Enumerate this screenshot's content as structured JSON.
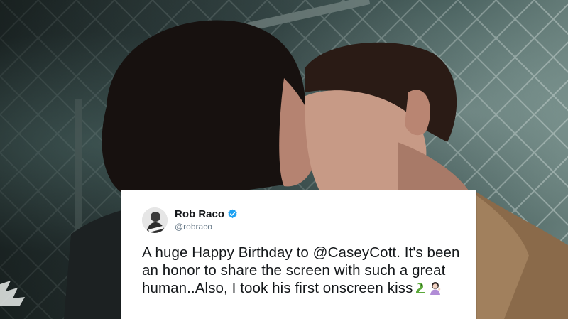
{
  "tweet": {
    "display_name": "Rob Raco",
    "handle": "@robraco",
    "text": "A huge Happy Birthday to @CaseyCott. It's been an honor to share the screen with such a great human..Also, I took his first onscreen kiss",
    "verified": true,
    "emojis": [
      "snake-emoji",
      "woman-tipping-hand-emoji"
    ]
  },
  "colors": {
    "verified_blue": "#1da1f2",
    "text_primary": "#14171a",
    "text_secondary": "#657786",
    "card_background": "#ffffff"
  }
}
